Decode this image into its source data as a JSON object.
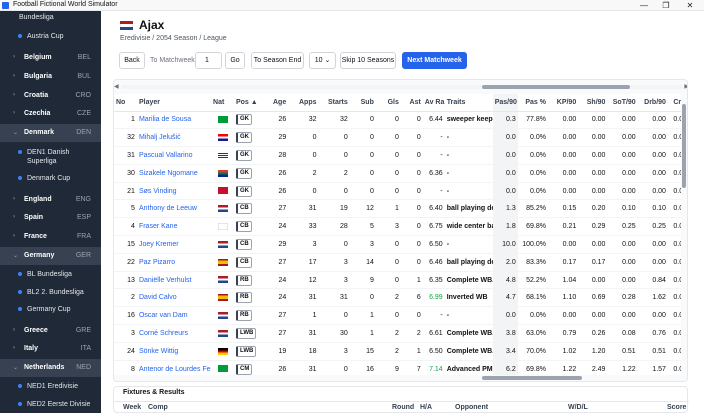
{
  "window": {
    "title": "Football Fictional World Simulator",
    "minimize": "—",
    "restore": "❐",
    "close": "✕"
  },
  "sidebar": {
    "top_label": "Bundesliga",
    "austria_cup": "Austria Cup",
    "items": [
      {
        "name": "Belgium",
        "code": "BEL"
      },
      {
        "name": "Bulgaria",
        "code": "BUL"
      },
      {
        "name": "Croatia",
        "code": "CRO"
      },
      {
        "name": "Czechia",
        "code": "CZE"
      },
      {
        "name": "Denmark",
        "code": "DEN"
      },
      {
        "name": "England",
        "code": "ENG"
      },
      {
        "name": "Spain",
        "code": "ESP"
      },
      {
        "name": "France",
        "code": "FRA"
      },
      {
        "name": "Germany",
        "code": "GER"
      },
      {
        "name": "Greece",
        "code": "GRE"
      },
      {
        "name": "Italy",
        "code": "ITA"
      },
      {
        "name": "Netherlands",
        "code": "NED"
      }
    ],
    "den_sub": [
      "DEN1 Danish Superliga",
      "Denmark Cup"
    ],
    "ger_sub": [
      "BL Bundesliga",
      "BL2 2. Bundesliga",
      "Germany Cup"
    ],
    "ned_sub": [
      "NED1 Eredivisie",
      "NED2 Eerste Divisie"
    ]
  },
  "header": {
    "club": "Ajax",
    "subtitle": "Eredivisie / 2054 Season / League"
  },
  "toolbar": {
    "back": "Back",
    "to_matchweek": "To Matchweek",
    "matchweek_value": "1",
    "go": "Go",
    "to_season_end": "To Season End",
    "seasons_select": "10",
    "skip": "Skip 10 Seasons",
    "next": "Next Matchweek"
  },
  "scroll": {
    "left": "◀",
    "right": "▶"
  },
  "table": {
    "headers": [
      "No",
      "Player",
      "Nat",
      "Pos ▲",
      "Age",
      "Apps",
      "Starts",
      "Sub",
      "Gls",
      "Ast",
      "Av Ra",
      "Traits",
      "Pas/90",
      "Pas %",
      "KP/90",
      "Sh/90",
      "SoT/90",
      "Drb/90",
      "Crs/"
    ],
    "rows": [
      {
        "no": "1",
        "name": "Marilia de Sousa",
        "nat": "BRA",
        "pos": "GK",
        "age": "26",
        "apps": "32",
        "starts": "32",
        "sub": "0",
        "gls": "0",
        "ast": "0",
        "av": "6.44",
        "traits": "sweeper keepe",
        "pas90": "0.3",
        "pasp": "77.8%",
        "kp": "0.00",
        "sh": "0.00",
        "sot": "0.00",
        "drb": "0.00",
        "crs": "0.00"
      },
      {
        "no": "32",
        "name": "Mihalj Jelušić",
        "nat": "CRO",
        "pos": "GK",
        "age": "29",
        "apps": "0",
        "starts": "0",
        "sub": "0",
        "gls": "0",
        "ast": "0",
        "av": "-",
        "traits": "-",
        "pas90": "0.0",
        "pasp": "0.0%",
        "kp": "0.00",
        "sh": "0.00",
        "sot": "0.00",
        "drb": "0.00",
        "crs": "0.00"
      },
      {
        "no": "31",
        "name": "Pascual Vallarino",
        "nat": "URU",
        "pos": "GK",
        "age": "28",
        "apps": "0",
        "starts": "0",
        "sub": "0",
        "gls": "0",
        "ast": "0",
        "av": "-",
        "traits": "-",
        "pas90": "0.0",
        "pasp": "0.0%",
        "kp": "0.00",
        "sh": "0.00",
        "sot": "0.00",
        "drb": "0.00",
        "crs": "0.00"
      },
      {
        "no": "30",
        "name": "Sizakele Ngomane",
        "nat": "RSA",
        "pos": "GK",
        "age": "26",
        "apps": "2",
        "starts": "2",
        "sub": "0",
        "gls": "0",
        "ast": "0",
        "av": "6.36",
        "traits": "-",
        "pas90": "0.0",
        "pasp": "0.0%",
        "kp": "0.00",
        "sh": "0.00",
        "sot": "0.00",
        "drb": "0.00",
        "crs": "0.00"
      },
      {
        "no": "21",
        "name": "Søs Vinding",
        "nat": "DEN",
        "pos": "GK",
        "age": "26",
        "apps": "0",
        "starts": "0",
        "sub": "0",
        "gls": "0",
        "ast": "0",
        "av": "-",
        "traits": "-",
        "pas90": "0.0",
        "pasp": "0.0%",
        "kp": "0.00",
        "sh": "0.00",
        "sot": "0.00",
        "drb": "0.00",
        "crs": "0.00"
      },
      {
        "no": "5",
        "name": "Anthony de Leeuw",
        "nat": "NED",
        "pos": "CB",
        "age": "27",
        "apps": "31",
        "starts": "19",
        "sub": "12",
        "gls": "1",
        "ast": "0",
        "av": "6.40",
        "traits": "ball playing de",
        "pas90": "1.3",
        "pasp": "85.2%",
        "kp": "0.15",
        "sh": "0.20",
        "sot": "0.10",
        "drb": "0.10",
        "crs": "0.00"
      },
      {
        "no": "4",
        "name": "Fraser Kane",
        "nat": "ENG",
        "pos": "CB",
        "age": "24",
        "apps": "33",
        "starts": "28",
        "sub": "5",
        "gls": "3",
        "ast": "0",
        "av": "6.75",
        "traits": "wide center ba",
        "pas90": "1.8",
        "pasp": "69.8%",
        "kp": "0.21",
        "sh": "0.29",
        "sot": "0.25",
        "drb": "0.25",
        "crs": "0.00"
      },
      {
        "no": "15",
        "name": "Joey Kremer",
        "nat": "NED",
        "pos": "CB",
        "age": "29",
        "apps": "3",
        "starts": "0",
        "sub": "3",
        "gls": "0",
        "ast": "0",
        "av": "6.50",
        "traits": "-",
        "pas90": "10.0",
        "pasp": "100.0%",
        "kp": "0.00",
        "sh": "0.00",
        "sot": "0.00",
        "drb": "0.00",
        "crs": "0.00"
      },
      {
        "no": "22",
        "name": "Paz Pizarro",
        "nat": "ESP",
        "pos": "CB",
        "age": "27",
        "apps": "17",
        "starts": "3",
        "sub": "14",
        "gls": "0",
        "ast": "0",
        "av": "6.46",
        "traits": "ball playing de",
        "pas90": "2.0",
        "pasp": "83.3%",
        "kp": "0.17",
        "sh": "0.17",
        "sot": "0.00",
        "drb": "0.00",
        "crs": "0.00"
      },
      {
        "no": "13",
        "name": "Daniëlle Verhulst",
        "nat": "NED",
        "pos": "RB",
        "age": "24",
        "apps": "12",
        "starts": "3",
        "sub": "9",
        "gls": "0",
        "ast": "1",
        "av": "6.35",
        "traits": "Complete WB.",
        "pas90": "4.8",
        "pasp": "52.2%",
        "kp": "1.04",
        "sh": "0.00",
        "sot": "0.00",
        "drb": "0.84",
        "crs": "0.00"
      },
      {
        "no": "2",
        "name": "David Calvo",
        "nat": "ESP",
        "pos": "RB",
        "age": "24",
        "apps": "31",
        "starts": "31",
        "sub": "0",
        "gls": "2",
        "ast": "6",
        "av": "6.99",
        "traits": "Inverted WB",
        "pas90": "4.7",
        "pasp": "68.1%",
        "kp": "1.10",
        "sh": "0.69",
        "sot": "0.28",
        "drb": "1.62",
        "crs": "0.00"
      },
      {
        "no": "16",
        "name": "Oscar van Dam",
        "nat": "NED",
        "pos": "RB",
        "age": "27",
        "apps": "1",
        "starts": "0",
        "sub": "1",
        "gls": "0",
        "ast": "0",
        "av": "-",
        "traits": "-",
        "pas90": "0.0",
        "pasp": "0.0%",
        "kp": "0.00",
        "sh": "0.00",
        "sot": "0.00",
        "drb": "0.00",
        "crs": "0.00"
      },
      {
        "no": "3",
        "name": "Corné Schreurs",
        "nat": "NED",
        "pos": "LWB",
        "age": "27",
        "apps": "31",
        "starts": "30",
        "sub": "1",
        "gls": "2",
        "ast": "2",
        "av": "6.61",
        "traits": "Complete WB.",
        "pas90": "3.8",
        "pasp": "63.0%",
        "kp": "0.79",
        "sh": "0.26",
        "sot": "0.08",
        "drb": "0.76",
        "crs": "0.00"
      },
      {
        "no": "24",
        "name": "Sönke Wittig",
        "nat": "GER",
        "pos": "LWB",
        "age": "19",
        "apps": "18",
        "starts": "3",
        "sub": "15",
        "gls": "2",
        "ast": "1",
        "av": "6.50",
        "traits": "Complete WB.",
        "pas90": "3.4",
        "pasp": "70.0%",
        "kp": "1.02",
        "sh": "1.20",
        "sot": "0.51",
        "drb": "0.51",
        "crs": "0.00"
      },
      {
        "no": "8",
        "name": "Antenor de Lourdes Fer",
        "nat": "BRA",
        "pos": "CM",
        "age": "26",
        "apps": "31",
        "starts": "0",
        "sub": "16",
        "gls": "9",
        "ast": "7",
        "av": "7.14",
        "traits": "Advanced PM.",
        "pas90": "6.2",
        "pasp": "69.8%",
        "kp": "1.22",
        "sh": "2.49",
        "sot": "1.22",
        "drb": "1.57",
        "crs": "0.00"
      }
    ]
  },
  "fixtures": {
    "title": "Fixtures & Results",
    "headers": [
      "Week",
      "Comp",
      "Round",
      "H/A",
      "Opponent",
      "W/D/L",
      "Score"
    ]
  },
  "colors": {
    "sidebar": "#1f2937",
    "accent": "#2563eb",
    "link": "#2563eb",
    "good": "#16a34a"
  }
}
